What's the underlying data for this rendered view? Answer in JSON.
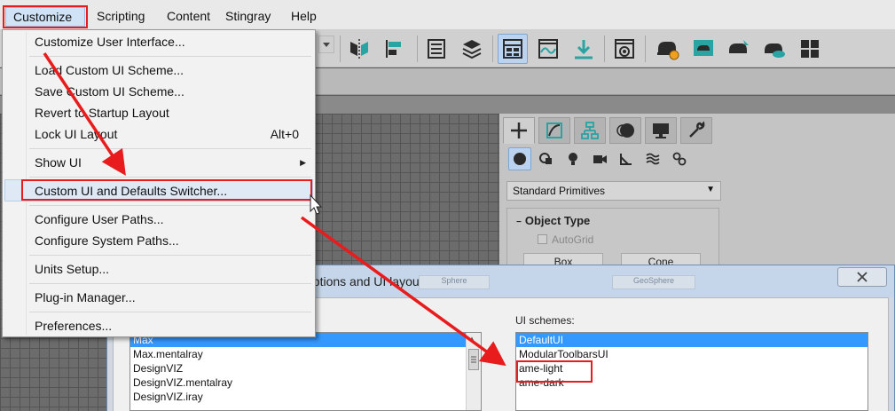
{
  "menubar": {
    "items": [
      "Customize",
      "Scripting",
      "Content",
      "Stingray",
      "Help"
    ]
  },
  "customize_menu": {
    "items": [
      {
        "label": "Customize User Interface..."
      },
      {
        "label": "Load Custom UI Scheme..."
      },
      {
        "label": "Save Custom UI Scheme..."
      },
      {
        "label": "Revert to Startup Layout"
      },
      {
        "label": "Lock UI Layout",
        "shortcut": "Alt+0"
      },
      {
        "label": "Show UI"
      },
      {
        "label": "Custom UI and Defaults Switcher..."
      },
      {
        "label": "Configure User Paths..."
      },
      {
        "label": "Configure System Paths..."
      },
      {
        "label": "Units Setup..."
      },
      {
        "label": "Plug-in Manager..."
      },
      {
        "label": "Preferences..."
      }
    ]
  },
  "command_panel": {
    "category": "Standard Primitives",
    "rollout_title": "Object Type",
    "autogrid_label": "AutoGrid",
    "buttons": [
      "Box",
      "Cone"
    ]
  },
  "dialog": {
    "title_partial": "options and UI layout.",
    "ghost_buttons": [
      "Sphere",
      "GeoSphere"
    ],
    "defaults_list": {
      "items": [
        "Max",
        "Max.mentalray",
        "DesignVIZ",
        "DesignVIZ.mentalray",
        "DesignVIZ.iray"
      ],
      "selected": "Max"
    },
    "ui_schemes": {
      "label": "UI schemes:",
      "items": [
        "DefaultUI",
        "ModularToolbarsUI",
        "ame-light",
        "ame-dark"
      ],
      "selected": "DefaultUI"
    }
  },
  "colors": {
    "annotation_red": "#e81c1c",
    "selection_blue": "#3399ff"
  }
}
